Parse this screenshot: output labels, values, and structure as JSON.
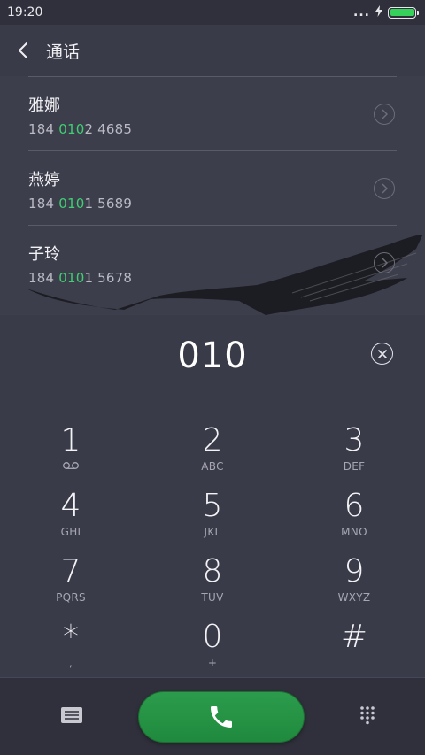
{
  "status_bar": {
    "time": "19:20",
    "more_dots": "...",
    "battery_level": 1.0,
    "colors": {
      "battery": "#36d15a"
    }
  },
  "header": {
    "title": "通话",
    "back_icon": "chevron-left-icon"
  },
  "contacts": [
    {
      "name": "雅娜",
      "num_prefix": "184 ",
      "num_match": "010",
      "num_rest": "2 4685"
    },
    {
      "name": "燕婷",
      "num_prefix": "184 ",
      "num_match": "010",
      "num_rest": "1 5689"
    },
    {
      "name": "子玲",
      "num_prefix": "184 ",
      "num_match": "010",
      "num_rest": "1 5678"
    }
  ],
  "dialer": {
    "entered_number": "010",
    "delete_icon": "clear-circle-icon",
    "keys": [
      {
        "digit": "1",
        "letters": "",
        "icon": "voicemail-icon"
      },
      {
        "digit": "2",
        "letters": "ABC"
      },
      {
        "digit": "3",
        "letters": "DEF"
      },
      {
        "digit": "4",
        "letters": "GHI"
      },
      {
        "digit": "5",
        "letters": "JKL"
      },
      {
        "digit": "6",
        "letters": "MNO"
      },
      {
        "digit": "7",
        "letters": "PQRS"
      },
      {
        "digit": "8",
        "letters": "TUV"
      },
      {
        "digit": "9",
        "letters": "WXYZ"
      },
      {
        "digit": "*",
        "letters": ","
      },
      {
        "digit": "0",
        "letters": "+"
      },
      {
        "digit": "#",
        "letters": ""
      }
    ]
  },
  "bottom_bar": {
    "left_icon": "message-icon",
    "call_icon": "phone-icon",
    "right_icon": "keypad-grid-icon",
    "colors": {
      "call_button": "#2c9b4c",
      "highlight": "#3fcf72"
    }
  }
}
